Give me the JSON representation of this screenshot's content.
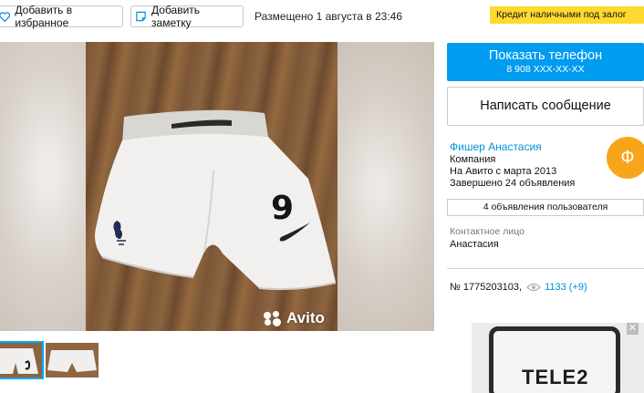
{
  "toolbar": {
    "favorite_label": "Добавить в избранное",
    "note_label": "Добавить заметку",
    "posted_text": "Размещено 1 августа в 23:46",
    "credit_label": "Кредит наличными под залог"
  },
  "gallery": {
    "watermark": "Avito",
    "shorts_number": "9"
  },
  "contact": {
    "show_phone_label": "Показать телефон",
    "phone_masked": "8 908 XXX-XX-XX",
    "message_label": "Написать сообщение"
  },
  "seller": {
    "name": "Фишер Анастасия",
    "type": "Компания",
    "since": "На Авито с марта 2013",
    "completed": "Завершено 24 объявления",
    "avatar_letter": "Ф",
    "ads_button": "4 объявления пользователя",
    "contact_label": "Контактное лицо",
    "contact_name": "Анастасия"
  },
  "listing": {
    "id_text": "№ 1775203103,",
    "views_text": "1133 (+9)"
  },
  "ad": {
    "brand": "TELE2",
    "close_symbol": "✕"
  },
  "colors": {
    "accent": "#009cf0",
    "link": "#0091d9",
    "credit_bg": "#ffd92e",
    "avatar_bg": "#f8a51c"
  }
}
